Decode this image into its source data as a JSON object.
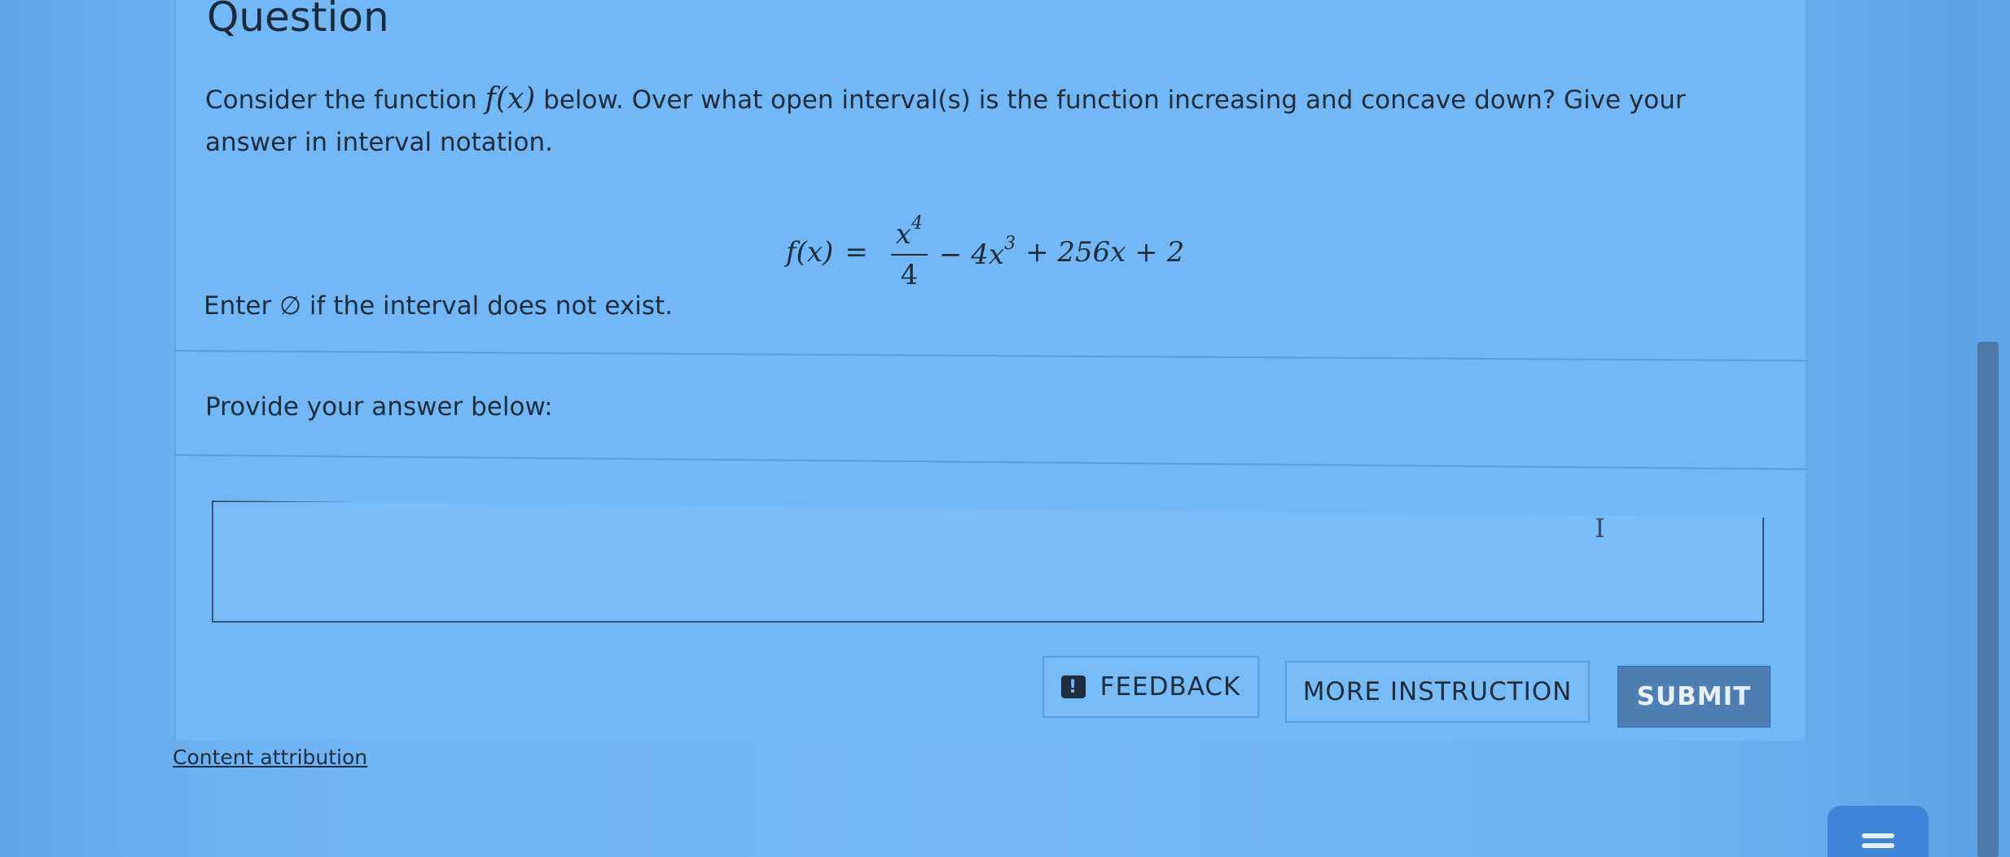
{
  "question": {
    "heading": "Question",
    "prompt_part1": "Consider the function ",
    "function_symbol": "f(x)",
    "prompt_part2": " below. Over what open interval(s) is the function increasing and concave down? Give your answer in interval notation.",
    "equation": {
      "lhs": "f(x)",
      "equals": "=",
      "frac_num": "x",
      "frac_num_exp": "4",
      "frac_den": "4",
      "term2": "− 4x",
      "term2_exp": "3",
      "term3": "+ 256x + 2"
    },
    "empty_set_note": "Enter ∅ if the interval does not exist."
  },
  "answer": {
    "label": "Provide your answer below:",
    "input_value": "",
    "input_placeholder": ""
  },
  "buttons": {
    "feedback_icon": "!",
    "feedback_label": "FEEDBACK",
    "more_instruction_label": "MORE INSTRUCTION",
    "submit_label": "SUBMIT"
  },
  "footer": {
    "attribution_label": "Content attribution"
  },
  "icons": {
    "feedback": "exclamation-icon",
    "text_cursor": "text-cursor-icon",
    "chat": "chat-menu-icon"
  },
  "colors": {
    "background": "#72b8f6",
    "submit": "#4f7fb2",
    "chat_button": "#3f86d8"
  }
}
